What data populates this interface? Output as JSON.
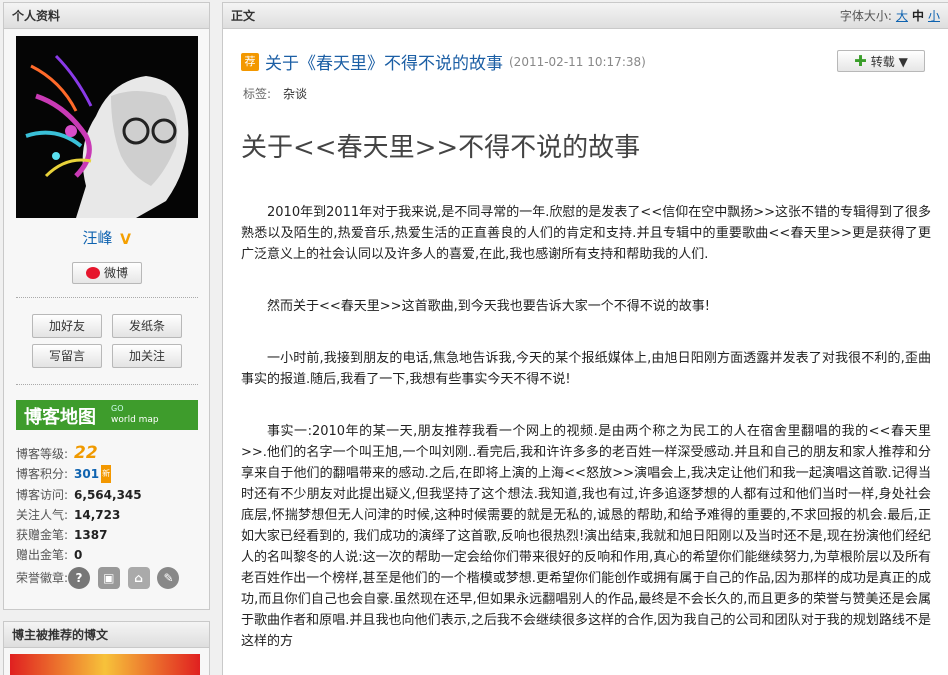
{
  "sidebar": {
    "profile_title": "个人资料",
    "nickname": "汪峰",
    "vip_badge": "V",
    "weibo_label": "微博",
    "actions": {
      "add_friend": "加好友",
      "send_note": "发纸条",
      "leave_message": "写留言",
      "follow": "加关注"
    },
    "blog_map": {
      "title": "博客地图",
      "subtitle": "world map",
      "tag": "GO"
    },
    "stats": [
      {
        "label": "博客等级:",
        "value": "22"
      },
      {
        "label": "博客积分:",
        "value": "301"
      },
      {
        "label": "博客访问:",
        "value": "6,564,345"
      },
      {
        "label": "关注人气:",
        "value": "14,723"
      },
      {
        "label": "获赠金笔:",
        "value": "1387"
      },
      {
        "label": "赠出金笔:",
        "value": "0"
      }
    ],
    "new_badge": "新",
    "medals_label": "荣誉徽章:",
    "recommend_title": "博主被推荐的博文"
  },
  "article": {
    "panel_title": "正文",
    "font_size_label": "字体大小:",
    "font_sizes": [
      "大",
      "中",
      "小"
    ],
    "recommend_badge": "荐",
    "title": "关于《春天里》不得不说的故事",
    "time": "(2011-02-11 10:17:38)",
    "share_label": "转载",
    "tags_label": "标签:",
    "tag": "杂谈",
    "heading": "关于<<春天里>>不得不说的故事",
    "paragraphs": [
      "2010年到2011年对于我来说,是不同寻常的一年.欣慰的是发表了<<信仰在空中飘扬>>这张不错的专辑得到了很多熟悉以及陌生的,热爱音乐,热爱生活的正直善良的人们的肯定和支持.并且专辑中的重要歌曲<<春天里>>更是获得了更广泛意义上的社会认同以及许多人的喜爱,在此,我也感谢所有支持和帮助我的人们.",
      "然而关于<<春天里>>这首歌曲,到今天我也要告诉大家一个不得不说的故事!",
      "一小时前,我接到朋友的电话,焦急地告诉我,今天的某个报纸媒体上,由旭日阳刚方面透露并发表了对我很不利的,歪曲事实的报道.随后,我看了一下,我想有些事实今天不得不说!",
      "事实一:2010年的某一天,朋友推荐我看一个网上的视频.是由两个称之为民工的人在宿舍里翻唱的我的<<春天里>>.他们的名字一个叫王旭,一个叫刘刚..看完后,我和许许多多的老百姓一样深受感动.并且和自己的朋友和家人推荐和分享来自于他们的翻唱带来的感动.之后,在即将上演的上海<<怒放>>演唱会上,我决定让他们和我一起演唱这首歌.记得当时还有不少朋友对此提出疑义,但我坚持了这个想法.我知道,我也有过,许多追逐梦想的人都有过和他们当时一样,身处社会底层,怀揣梦想但无人问津的时候,这种时候需要的就是无私的,诚恳的帮助,和给予难得的重要的,不求回报的机会.最后,正如大家已经看到的, 我们成功的演绎了这首歌,反响也很热烈!演出结束,我就和旭日阳刚以及当时还不是,现在扮演他们经纪人的名叫黎冬的人说:这一次的帮助一定会给你们带来很好的反响和作用,真心的希望你们能继续努力,为草根阶层以及所有老百姓作出一个榜样,甚至是他们的一个楷模或梦想.更希望你们能创作或拥有属于自己的作品,因为那样的成功是真正的成功,而且你们自己也会自豪.虽然现在还早,但如果永远翻唱别人的作品,最终是不会长久的,而且更多的荣誉与赞美还是会属于歌曲作者和原唱.并且我也向他们表示,之后我不会继续很多这样的合作,因为我自己的公司和团队对于我的规划路线不是这样的方"
    ]
  }
}
